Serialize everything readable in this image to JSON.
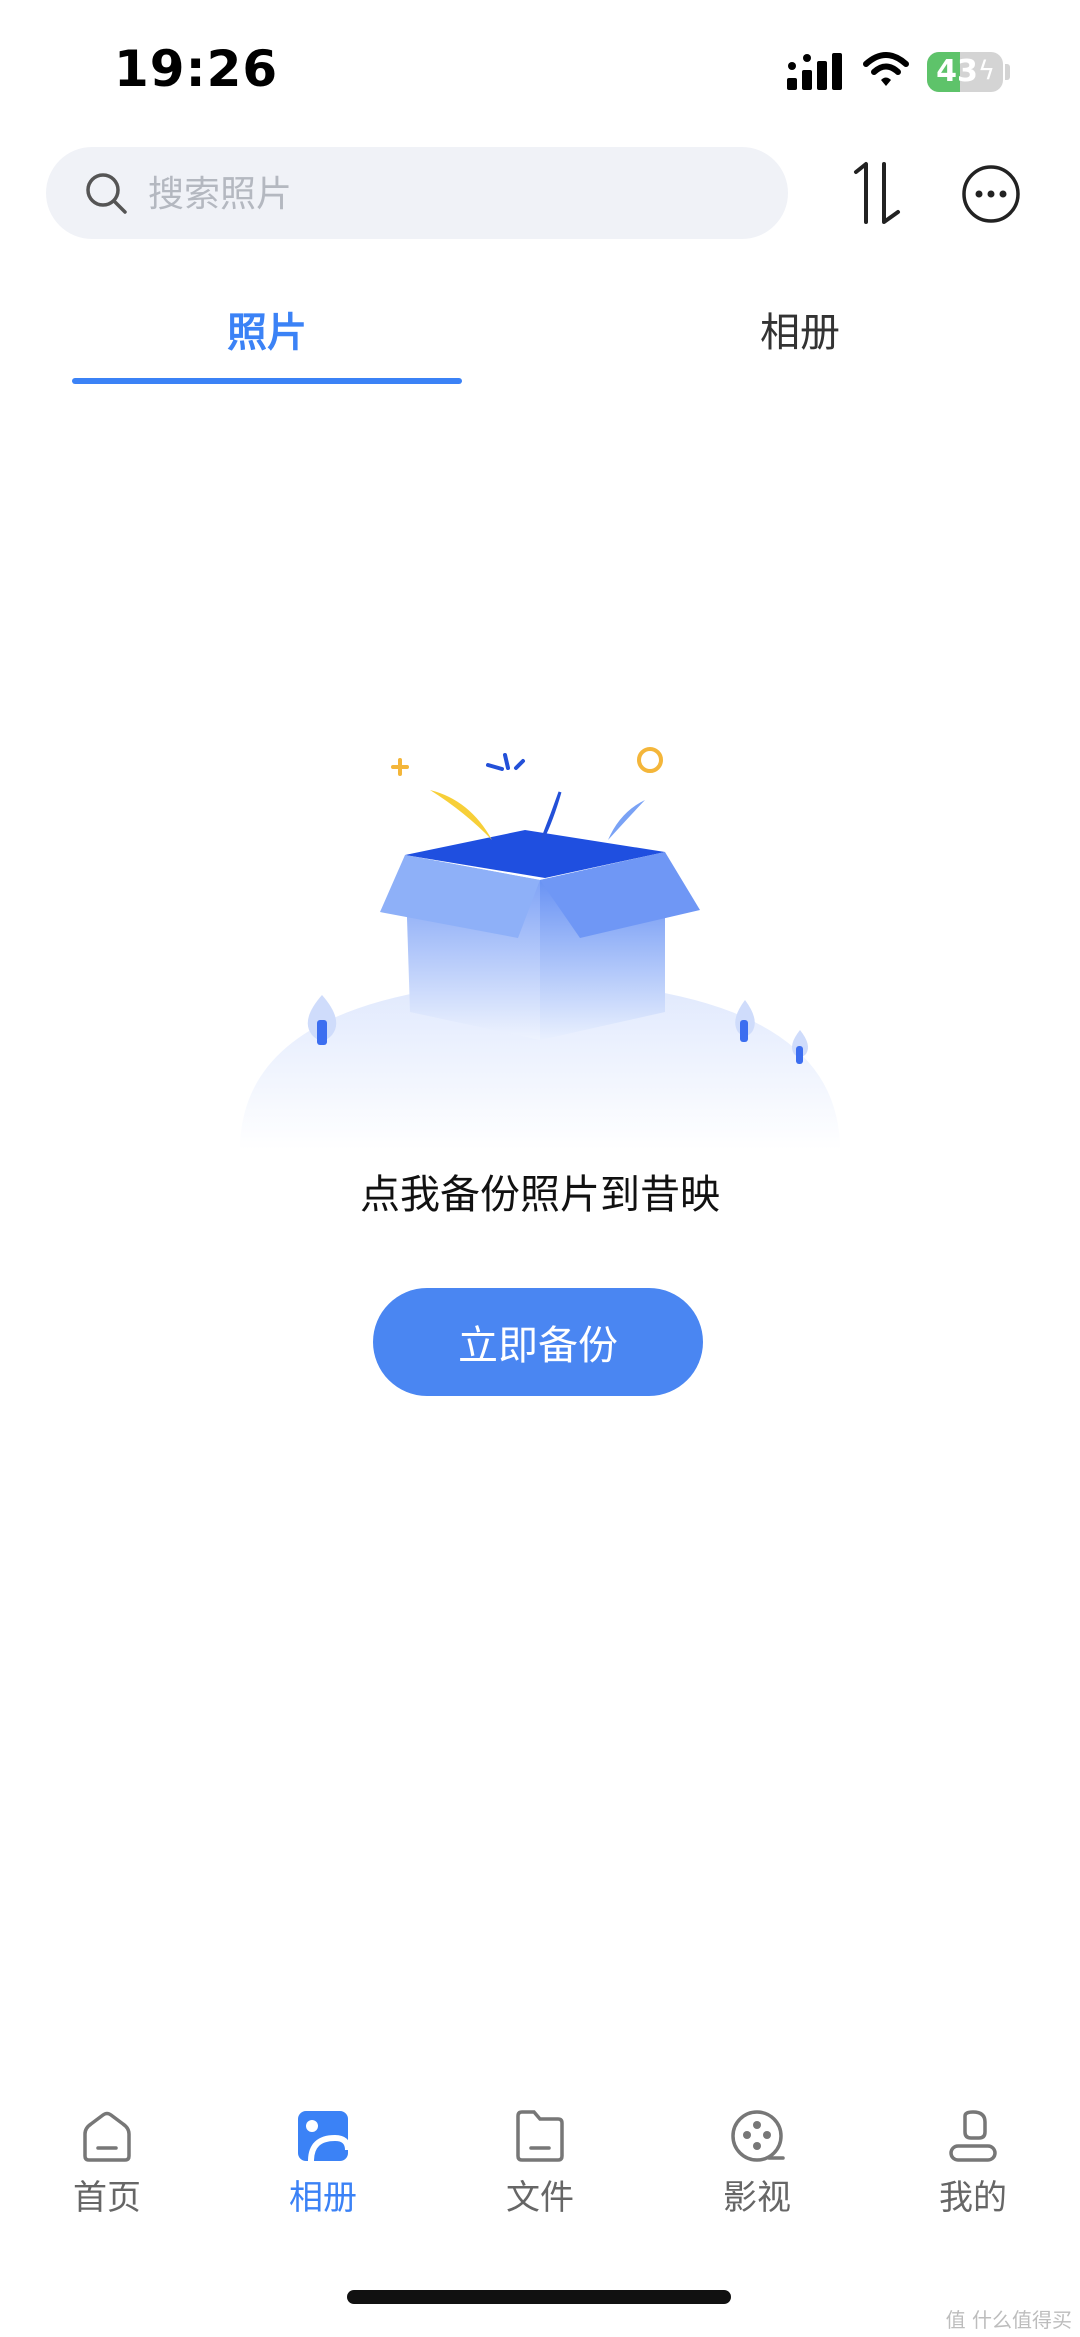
{
  "status_bar": {
    "time": "19:26",
    "battery": "43"
  },
  "search": {
    "placeholder": "搜索照片"
  },
  "tabs": [
    {
      "label": "照片",
      "active": true
    },
    {
      "label": "相册",
      "active": false
    }
  ],
  "empty_state": {
    "message": "点我备份照片到昔映",
    "button_label": "立即备份"
  },
  "bottom_nav": [
    {
      "label": "首页",
      "icon": "home-icon",
      "active": false
    },
    {
      "label": "相册",
      "icon": "album-icon",
      "active": true
    },
    {
      "label": "文件",
      "icon": "file-icon",
      "active": false
    },
    {
      "label": "影视",
      "icon": "film-reel-icon",
      "active": false
    },
    {
      "label": "我的",
      "icon": "profile-icon",
      "active": false
    }
  ],
  "watermark": "值 什么值得买",
  "colors": {
    "accent": "#3b82f6",
    "button": "#4a86f2",
    "search_bg": "#f0f2f7"
  }
}
